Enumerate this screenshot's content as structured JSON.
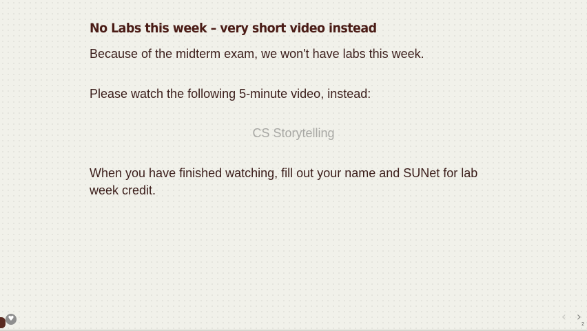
{
  "slide": {
    "title": "No Labs this week – very short video instead",
    "paragraph1": "Because of the midterm exam, we won't have labs this week.",
    "paragraph2": "Please watch the following 5-minute video, instead:",
    "video_link": "CS Storytelling",
    "paragraph3": "When you have finished watching, fill out your name and SUNet for lab week credit."
  },
  "controls": {
    "heart_icon": "♥",
    "prev_icon": "‹",
    "next_icon": "›",
    "page_number": "2"
  },
  "colors": {
    "background": "#f1f1ea",
    "title": "#4a1c16",
    "text": "#3a1d1a",
    "link": "#a8a8a4"
  }
}
